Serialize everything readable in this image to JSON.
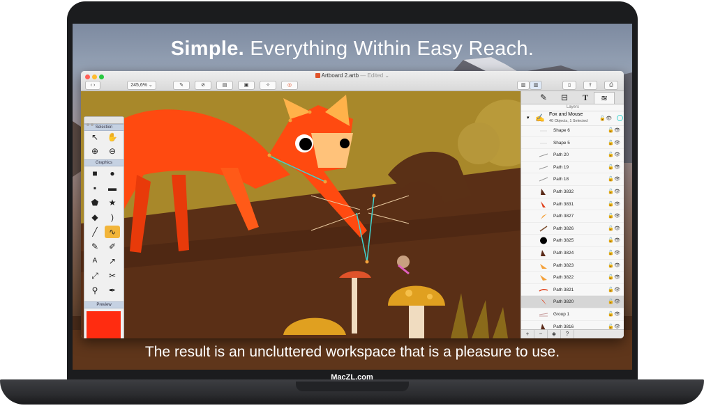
{
  "headline": {
    "bold": "Simple.",
    "rest": " Everything Within Easy Reach."
  },
  "caption": "The result is an uncluttered workspace that is a pleasure to use.",
  "brand": "MacZL.com",
  "window": {
    "zoom": "245,6%",
    "title": "Artboard 2.artb",
    "edited": " — Edited ⌄",
    "traffic_colors": [
      "#ff5f57",
      "#febc2e",
      "#28c840"
    ]
  },
  "tools": {
    "selection_header": "Selection",
    "graphics_header": "Graphics",
    "preview_header": "Preview",
    "preview_color": "#ff2c10",
    "text_tool": "A"
  },
  "layers": {
    "panel_title": "Layers",
    "group_name": "Fox and Mouse",
    "group_info": "40 Objects, 1 Selected",
    "items": [
      {
        "name": "Shape 6",
        "icon": "dash"
      },
      {
        "name": "Shape 5",
        "icon": "dash"
      },
      {
        "name": "Path 20",
        "icon": "stroke"
      },
      {
        "name": "Path 19",
        "icon": "stroke"
      },
      {
        "name": "Path 18",
        "icon": "stroke"
      },
      {
        "name": "Path 3832",
        "icon": "dark-shard"
      },
      {
        "name": "Path 3831",
        "icon": "red-shard"
      },
      {
        "name": "Path 3827",
        "icon": "orange-shard"
      },
      {
        "name": "Path 3826",
        "icon": "brown-stroke"
      },
      {
        "name": "Path 3825",
        "icon": "black-dot"
      },
      {
        "name": "Path 3824",
        "icon": "dark-shard"
      },
      {
        "name": "Path 3823",
        "icon": "orange-shard"
      },
      {
        "name": "Path 3822",
        "icon": "orange-shard"
      },
      {
        "name": "Path 3821",
        "icon": "red-stroke"
      },
      {
        "name": "Path 3820",
        "icon": "red-shard",
        "selected": true
      },
      {
        "name": "Group 1",
        "icon": "stroke"
      },
      {
        "name": "Path 3816",
        "icon": "dark-shard"
      }
    ],
    "footer": [
      "+",
      "−",
      "◈",
      "?"
    ]
  }
}
